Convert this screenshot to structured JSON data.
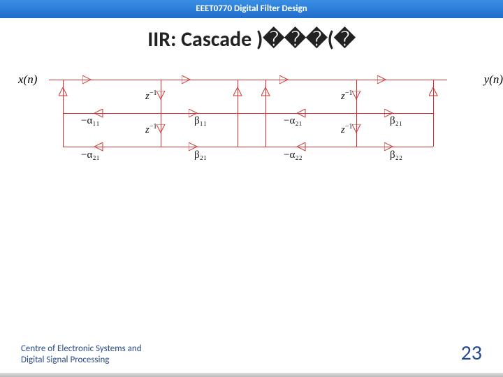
{
  "header": "EEET0770 Digital Filter Design",
  "title": "IIR: Cascade )���(�",
  "diagram": {
    "input_label": "x(n)",
    "output_label": "y(n)",
    "stages": [
      {
        "delays": [
          "z",
          "z"
        ],
        "delay_sup": "−1",
        "left_gains": [
          "−α₁₁",
          "−α₂₁"
        ],
        "right_gains": [
          "β₁₁",
          "β₂₁"
        ]
      },
      {
        "delays": [
          "z",
          "z"
        ],
        "delay_sup": "−1",
        "left_gains": [
          "−α₂₁",
          "−α₂₂"
        ],
        "right_gains": [
          "β₂₁",
          "β₂₂"
        ]
      }
    ]
  },
  "footer_left_line1": "Centre of Electronic Systems and",
  "footer_left_line2": "Digital Signal Processing",
  "page_number": "23"
}
